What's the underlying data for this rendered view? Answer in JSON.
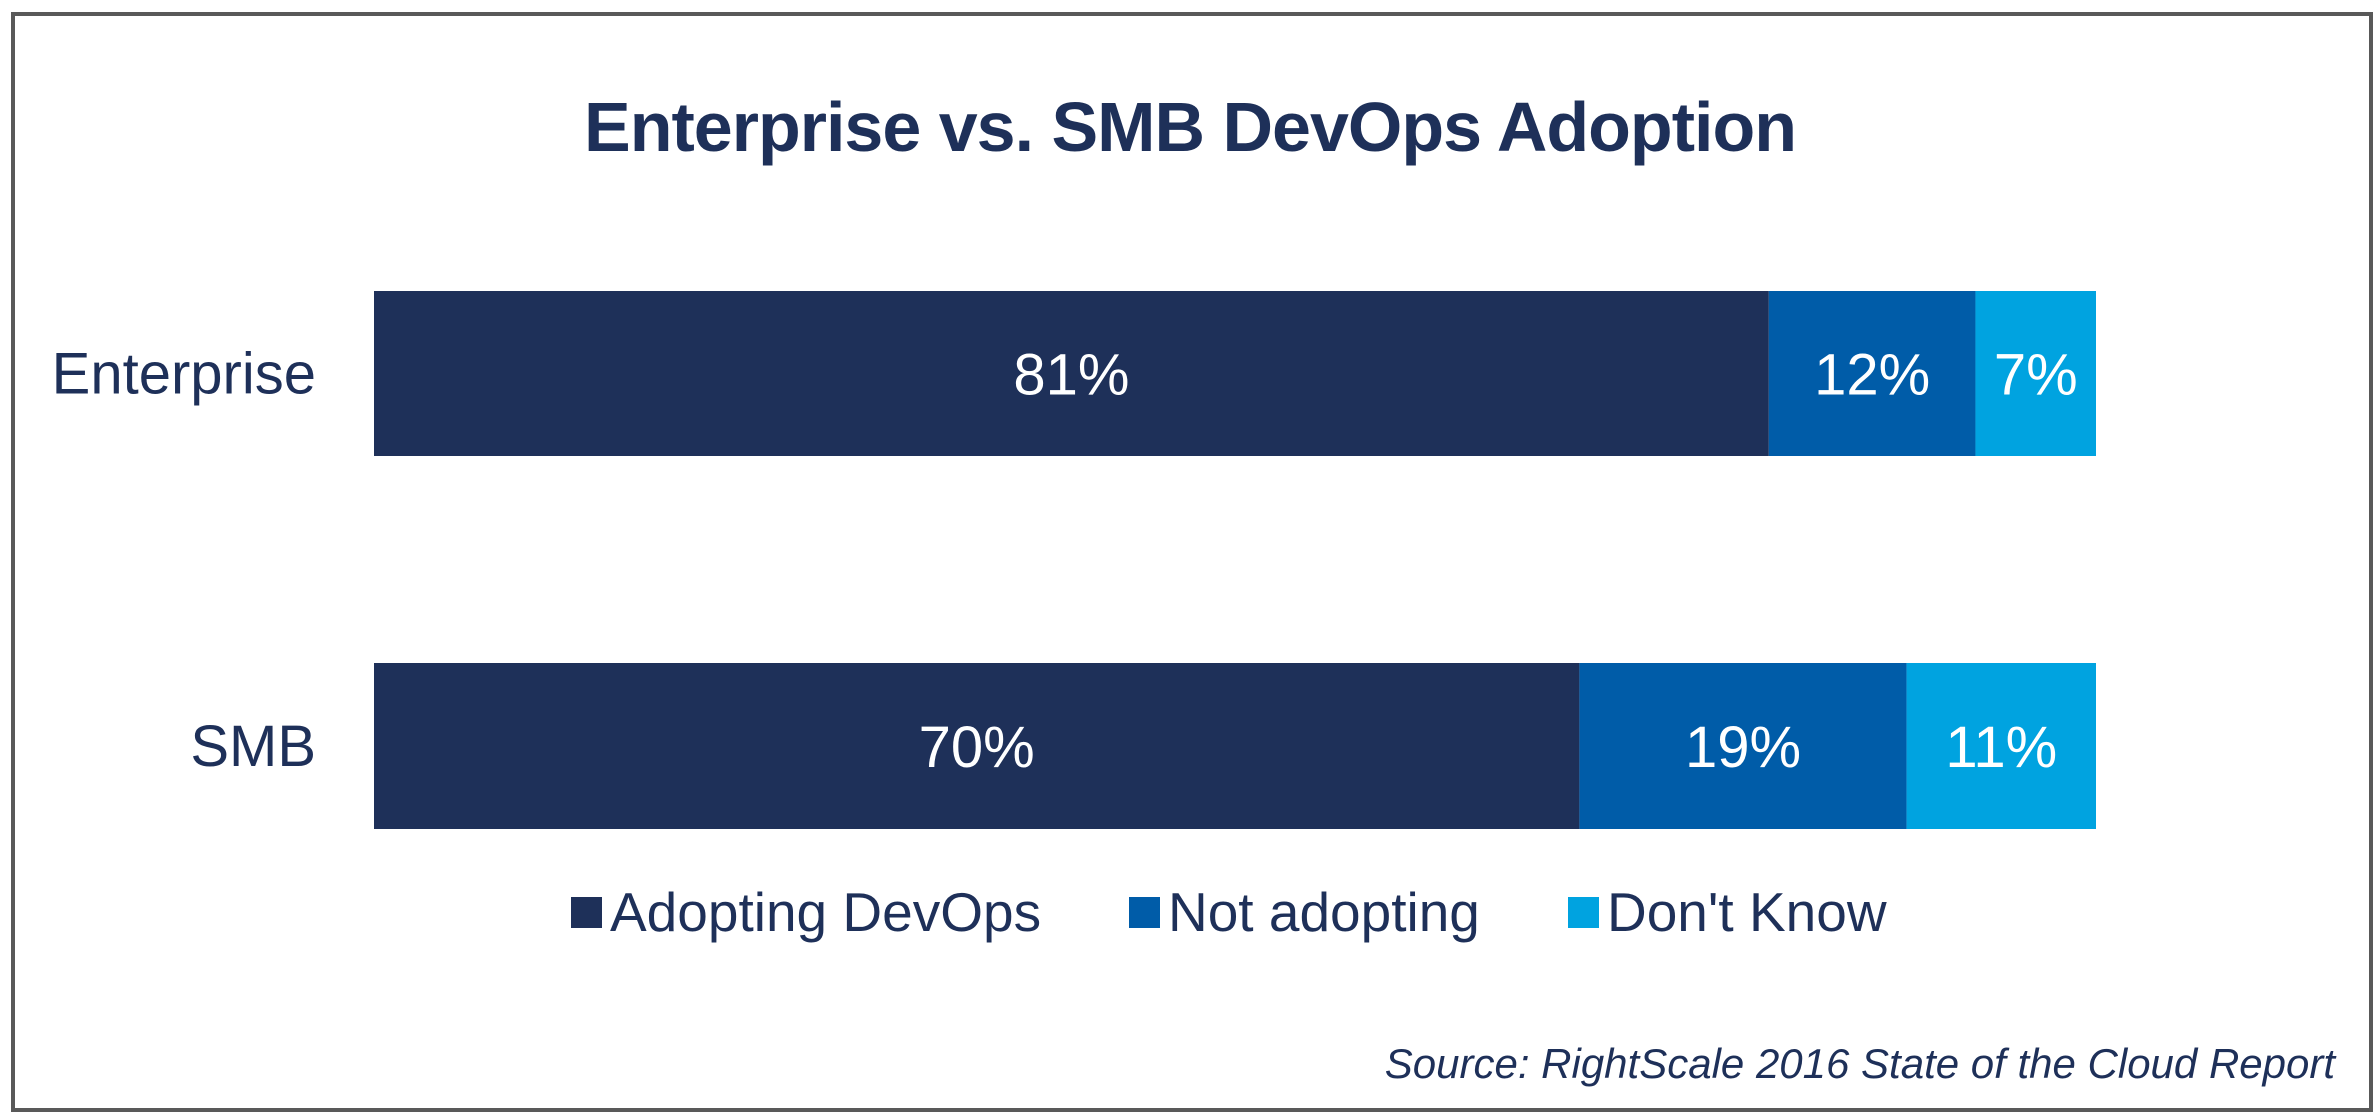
{
  "chart_data": {
    "type": "bar",
    "orientation": "horizontal",
    "stacked": true,
    "title": "Enterprise vs. SMB DevOps Adoption",
    "categories": [
      "Enterprise",
      "SMB"
    ],
    "series": [
      {
        "name": "Adopting DevOps",
        "color": "#1e3059",
        "values": [
          81,
          70
        ],
        "labels": [
          "81%",
          "70%"
        ]
      },
      {
        "name": "Not adopting",
        "color": "#005ca8",
        "values": [
          12,
          19
        ],
        "labels": [
          "12%",
          "19%"
        ]
      },
      {
        "name": "Don't Know",
        "color": "#00a3e0",
        "values": [
          7,
          11
        ],
        "labels": [
          "7%",
          "11%"
        ]
      }
    ],
    "xlim": [
      0,
      100
    ],
    "xlabel": "",
    "ylabel": "",
    "grid": false,
    "legend_position": "bottom-center",
    "source": "Source: RightScale 2016 State of the Cloud Report"
  },
  "text_color": "#1e3059",
  "border_color": "#595959"
}
